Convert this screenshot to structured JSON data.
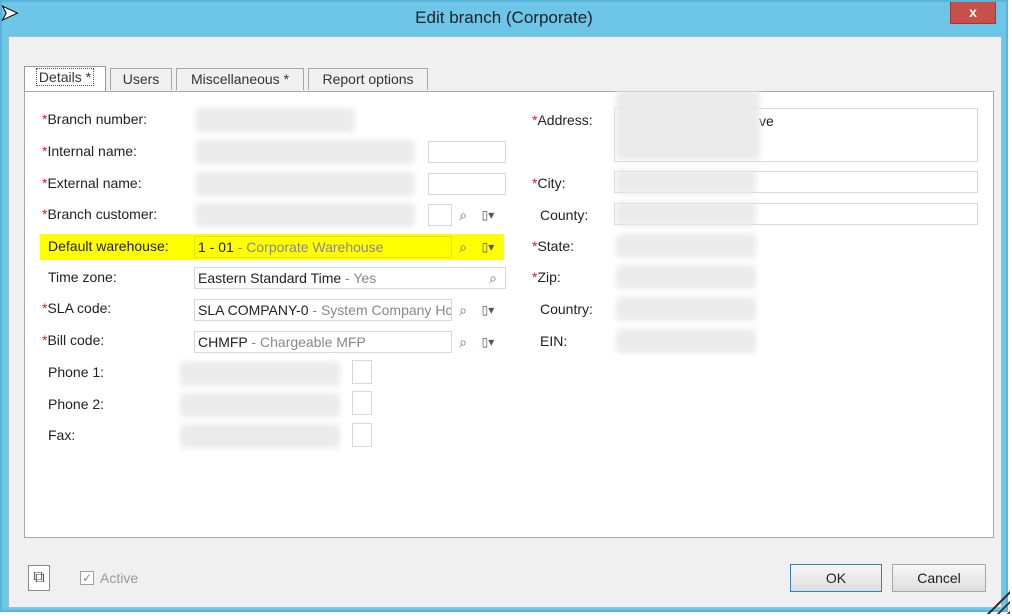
{
  "window": {
    "title": "Edit branch (Corporate)",
    "close_label": "x"
  },
  "tabs": [
    {
      "label": "Details *",
      "active": true
    },
    {
      "label": "Users",
      "active": false
    },
    {
      "label": "Miscellaneous *",
      "active": false
    },
    {
      "label": "Report options",
      "active": false
    }
  ],
  "left_fields": {
    "branch_number": {
      "label": "Branch number:",
      "required": "*"
    },
    "internal_name": {
      "label": "Internal name:",
      "required": "*"
    },
    "external_name": {
      "label": "External name:",
      "required": "*"
    },
    "branch_customer": {
      "label": "Branch customer:",
      "required": "*"
    },
    "default_warehouse": {
      "label": "Default warehouse:",
      "value": "1 - 01",
      "value_muted": " - Corporate Warehouse"
    },
    "time_zone": {
      "label": "Time zone:",
      "value": "Eastern Standard Time",
      "value_muted": " - Yes"
    },
    "sla_code": {
      "label": "SLA code:",
      "required": "*",
      "value": "SLA COMPANY-0",
      "value_muted": " - System Company Hc"
    },
    "bill_code": {
      "label": "Bill code:",
      "required": "*",
      "value": "CHMFP",
      "value_muted": " - Chargeable MFP"
    },
    "phone1": {
      "label": "Phone 1:"
    },
    "phone2": {
      "label": "Phone 2:"
    },
    "fax": {
      "label": "Fax:"
    }
  },
  "right_fields": {
    "address": {
      "label": "Address:",
      "required": "*",
      "value_fragment": "ve"
    },
    "city": {
      "label": "City:",
      "required": "*"
    },
    "county": {
      "label": "County:"
    },
    "state": {
      "label": "State:",
      "required": "*"
    },
    "zip": {
      "label": "Zip:",
      "required": "*"
    },
    "country": {
      "label": "Country:"
    },
    "ein": {
      "label": "EIN:"
    }
  },
  "footer": {
    "active_label": "Active",
    "active_checked": "✓",
    "ok_label": "OK",
    "cancel_label": "Cancel"
  },
  "icons": {
    "lookup": "🔍",
    "options": "▢▾",
    "copy": "⧉"
  },
  "colors": {
    "title_bar": "#6dc5e8",
    "highlight": "#ffff00",
    "required": "#d02020",
    "close": "#c7504a"
  }
}
